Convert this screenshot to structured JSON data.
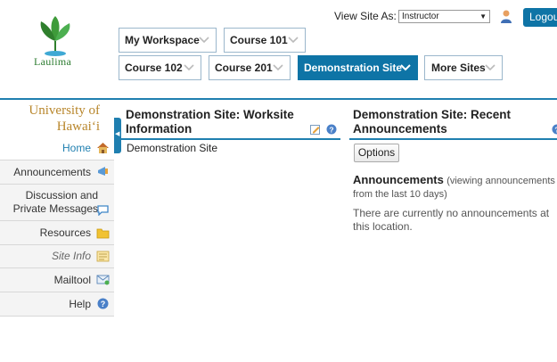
{
  "brand": {
    "logo_text": "Laulima",
    "university": "University of Hawaiʻi"
  },
  "header": {
    "view_site_as_label": "View Site As:",
    "view_site_as_value": "Instructor",
    "logout_label": "Logout"
  },
  "tabs": [
    {
      "label": "My Workspace"
    },
    {
      "label": "Course 101"
    },
    {
      "label": "Course 102"
    },
    {
      "label": "Course 201"
    },
    {
      "label": "Demonstration Site",
      "active": true
    },
    {
      "label": "More Sites"
    }
  ],
  "nav": [
    {
      "label": "Home",
      "icon": "home-icon",
      "active": true
    },
    {
      "label": "Announcements",
      "icon": "megaphone-icon"
    },
    {
      "label": "Discussion and Private Messages",
      "icon": "speech-bubble-icon"
    },
    {
      "label": "Resources",
      "icon": "folder-icon"
    },
    {
      "label": "Site Info",
      "icon": "site-info-icon"
    },
    {
      "label": "Mailtool",
      "icon": "mail-icon"
    },
    {
      "label": "Help",
      "icon": "help-icon"
    }
  ],
  "worksite": {
    "title": "Demonstration Site: Worksite Information",
    "body": "Demonstration Site"
  },
  "announcements": {
    "title": "Demonstration Site: Recent Announcements",
    "options_label": "Options",
    "heading": "Announcements",
    "subheading": "(viewing announcements from the last 10 days)",
    "empty_message": "There are currently no announcements at this location."
  },
  "colors": {
    "accent": "#0e74a6",
    "univ_gold": "#b8862b"
  }
}
